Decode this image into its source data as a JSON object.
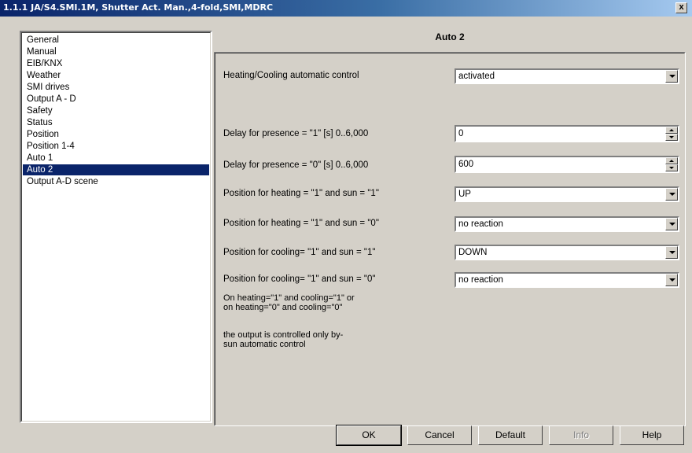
{
  "window": {
    "title": "1.1.1 JA/S4.SMI.1M, Shutter Act. Man.,4-fold,SMI,MDRC",
    "close_label": "x"
  },
  "nav": {
    "items": [
      {
        "label": "General"
      },
      {
        "label": "Manual"
      },
      {
        "label": "EIB/KNX"
      },
      {
        "label": "Weather"
      },
      {
        "label": "SMI drives"
      },
      {
        "label": "Output A - D"
      },
      {
        "label": "Safety"
      },
      {
        "label": "Status"
      },
      {
        "label": "Position"
      },
      {
        "label": "Position 1-4"
      },
      {
        "label": "Auto 1"
      },
      {
        "label": "Auto 2",
        "selected": true
      },
      {
        "label": "Output A-D scene"
      }
    ]
  },
  "page": {
    "title": "Auto 2",
    "params": [
      {
        "label": "Heating/Cooling automatic control",
        "type": "select",
        "value": "activated"
      },
      {
        "label": "Delay for presence = \"1\" [s] 0..6,000",
        "type": "spin",
        "value": "0"
      },
      {
        "label": "Delay for presence = \"0\" [s] 0..6,000",
        "type": "spin",
        "value": "600"
      },
      {
        "label": "Position for heating = \"1\" and sun = \"1\"",
        "type": "select",
        "value": "UP"
      },
      {
        "label": "Position for heating = \"1\" and sun = \"0\"",
        "type": "select",
        "value": "no reaction"
      },
      {
        "label": "Position for cooling= \"1\" and sun = \"1\"",
        "type": "select",
        "value": "DOWN"
      },
      {
        "label": "Position for cooling= \"1\" and sun = \"0\"",
        "type": "select",
        "value": "no reaction"
      }
    ],
    "note1_line1": "On heating=\"1\" and cooling=\"1\" or",
    "note1_line2": "on heating=\"0\" and cooling=\"0\"",
    "note2_line1": "the output is controlled only by-",
    "note2_line2": "sun automatic control"
  },
  "buttons": {
    "ok": "OK",
    "cancel": "Cancel",
    "default": "Default",
    "info": "Info",
    "help": "Help"
  }
}
